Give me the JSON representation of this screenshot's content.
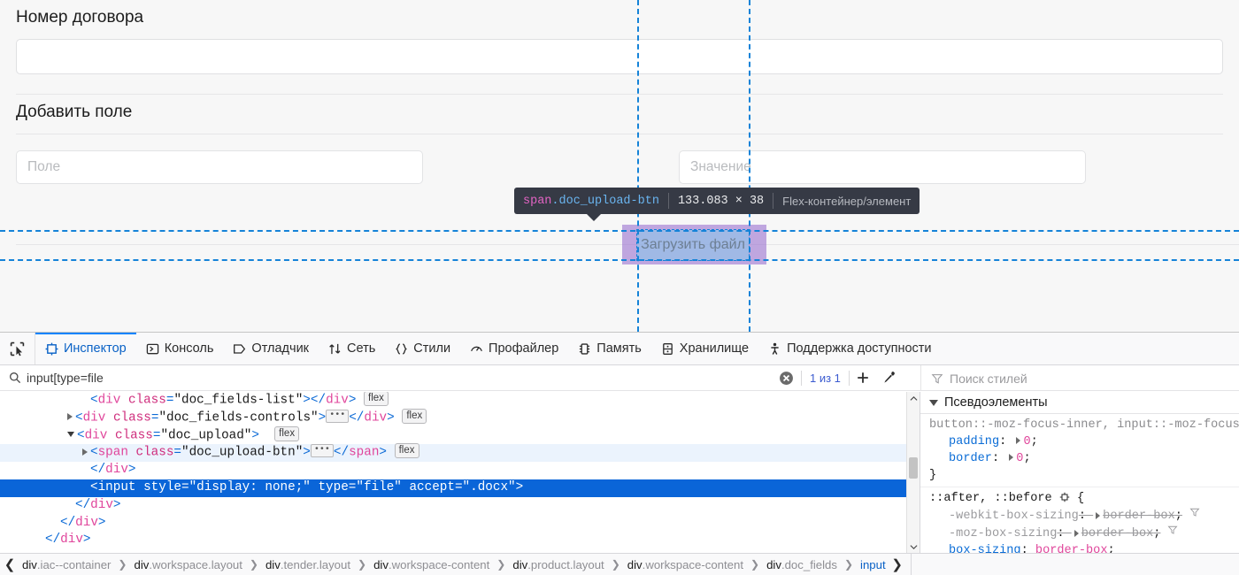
{
  "page": {
    "contract_label": "Номер договора",
    "contract_value": "",
    "add_field_label": "Добавить поле",
    "field_placeholder": "Поле",
    "value_placeholder": "Значение",
    "upload_button_label": "Загрузить файл"
  },
  "highlight": {
    "infobar": {
      "tag": "span",
      "class": ".doc_upload-btn",
      "dimensions": "133.083 × 38",
      "note": "Flex-контейнер/элемент"
    },
    "colors": {
      "margin_box": "#9265cc",
      "content_box": "#87c9e9",
      "guide_line": "#1583d8",
      "infobar_bg": "#363a45"
    }
  },
  "devtools": {
    "picker_icon": "node-picker-icon",
    "tabs": [
      {
        "label": "Инспектор",
        "icon": "inspector-icon",
        "active": true
      },
      {
        "label": "Консоль",
        "icon": "console-icon",
        "active": false
      },
      {
        "label": "Отладчик",
        "icon": "debugger-icon",
        "active": false
      },
      {
        "label": "Сеть",
        "icon": "network-icon",
        "active": false
      },
      {
        "label": "Стили",
        "icon": "style-editor-icon",
        "active": false
      },
      {
        "label": "Профайлер",
        "icon": "performance-icon",
        "active": false
      },
      {
        "label": "Память",
        "icon": "memory-icon",
        "active": false
      },
      {
        "label": "Хранилище",
        "icon": "storage-icon",
        "active": false
      },
      {
        "label": "Поддержка доступности",
        "icon": "accessibility-icon",
        "active": false
      }
    ],
    "search": {
      "value": "input[type=file",
      "icon": "search-icon",
      "clear_icon": "clear-icon",
      "match_count": "1 из 1",
      "add_icon": "plus-icon",
      "eyedropper_icon": "eyedropper-icon"
    },
    "styles_filter": {
      "placeholder": "Поиск стилей",
      "icon": "filter-icon"
    },
    "dom": {
      "rows": [
        {
          "indent": 5,
          "twisty": "none",
          "parts": [
            {
              "t": "punct",
              "v": "<"
            },
            {
              "t": "tagname",
              "v": "div"
            },
            {
              "t": "space",
              "v": " "
            },
            {
              "t": "attrname",
              "v": "class"
            },
            {
              "t": "punct",
              "v": "="
            },
            {
              "t": "attrval",
              "v": "\"doc_fields-list\""
            },
            {
              "t": "punct",
              "v": ">"
            },
            {
              "t": "punct",
              "v": "</"
            },
            {
              "t": "tagname",
              "v": "div"
            },
            {
              "t": "punct",
              "v": ">"
            },
            {
              "t": "badge",
              "v": "flex"
            }
          ]
        },
        {
          "indent": 4,
          "twisty": "closed",
          "parts": [
            {
              "t": "punct",
              "v": "<"
            },
            {
              "t": "tagname",
              "v": "div"
            },
            {
              "t": "space",
              "v": " "
            },
            {
              "t": "attrname",
              "v": "class"
            },
            {
              "t": "punct",
              "v": "="
            },
            {
              "t": "attrval",
              "v": "\"doc_fields-controls\""
            },
            {
              "t": "punct",
              "v": ">"
            },
            {
              "t": "ellipsis",
              "v": "…"
            },
            {
              "t": "punct",
              "v": "</"
            },
            {
              "t": "tagname",
              "v": "div"
            },
            {
              "t": "punct",
              "v": ">"
            },
            {
              "t": "badge",
              "v": "flex"
            }
          ]
        },
        {
          "indent": 4,
          "twisty": "open",
          "parts": [
            {
              "t": "punct",
              "v": "<"
            },
            {
              "t": "tagname",
              "v": "div"
            },
            {
              "t": "space",
              "v": " "
            },
            {
              "t": "attrname",
              "v": "class"
            },
            {
              "t": "punct",
              "v": "="
            },
            {
              "t": "attrval",
              "v": "\"doc_upload\""
            },
            {
              "t": "punct",
              "v": ">"
            },
            {
              "t": "space",
              "v": " "
            },
            {
              "t": "badge",
              "v": "flex"
            }
          ]
        },
        {
          "indent": 5,
          "twisty": "closed",
          "highlighted": true,
          "parts": [
            {
              "t": "punct",
              "v": "<"
            },
            {
              "t": "tagname",
              "v": "span"
            },
            {
              "t": "space",
              "v": " "
            },
            {
              "t": "attrname",
              "v": "class"
            },
            {
              "t": "punct",
              "v": "="
            },
            {
              "t": "attrval",
              "v": "\"doc_upload-btn\""
            },
            {
              "t": "punct",
              "v": ">"
            },
            {
              "t": "ellipsis",
              "v": "…"
            },
            {
              "t": "punct",
              "v": "</"
            },
            {
              "t": "tagname",
              "v": "span"
            },
            {
              "t": "punct",
              "v": ">"
            },
            {
              "t": "badge",
              "v": "flex"
            }
          ]
        },
        {
          "indent": 5,
          "twisty": "none",
          "parts": [
            {
              "t": "punct",
              "v": "</"
            },
            {
              "t": "tagname",
              "v": "div"
            },
            {
              "t": "punct",
              "v": ">"
            }
          ]
        },
        {
          "indent": 5,
          "twisty": "none",
          "selected": true,
          "parts": [
            {
              "t": "punct",
              "v": "<"
            },
            {
              "t": "tagname",
              "v": "input"
            },
            {
              "t": "space",
              "v": " "
            },
            {
              "t": "attrname",
              "v": "style"
            },
            {
              "t": "punct",
              "v": "="
            },
            {
              "t": "attrval",
              "v": "\"display: none;\""
            },
            {
              "t": "space",
              "v": " "
            },
            {
              "t": "attrname",
              "v": "type"
            },
            {
              "t": "punct",
              "v": "="
            },
            {
              "t": "attrval",
              "v": "\"file\""
            },
            {
              "t": "space",
              "v": " "
            },
            {
              "t": "attrname",
              "v": "accept"
            },
            {
              "t": "punct",
              "v": "="
            },
            {
              "t": "attrval",
              "v": "\".docx\""
            },
            {
              "t": "punct",
              "v": ">"
            }
          ]
        },
        {
          "indent": 4,
          "twisty": "none",
          "parts": [
            {
              "t": "punct",
              "v": "</"
            },
            {
              "t": "tagname",
              "v": "div"
            },
            {
              "t": "punct",
              "v": ">"
            }
          ]
        },
        {
          "indent": 3,
          "twisty": "none",
          "parts": [
            {
              "t": "punct",
              "v": "</"
            },
            {
              "t": "tagname",
              "v": "div"
            },
            {
              "t": "punct",
              "v": ">"
            }
          ]
        },
        {
          "indent": 2,
          "twisty": "none",
          "parts": [
            {
              "t": "punct",
              "v": "</"
            },
            {
              "t": "tagname",
              "v": "div"
            },
            {
              "t": "punct",
              "v": ">"
            }
          ]
        }
      ]
    },
    "styles": {
      "pseudo_header": "Псевдоэлементы",
      "rules": [
        {
          "selector": "button::-moz-focus-inner, input::-moz-focus-i",
          "selector_muted": true,
          "declarations": [
            {
              "prop": "padding",
              "value": "0",
              "expander": true,
              "struck": false,
              "filter": false
            },
            {
              "prop": "border",
              "value": "0",
              "expander": true,
              "struck": false,
              "filter": false
            }
          ]
        },
        {
          "selector": "::after, ::before",
          "selector_muted": false,
          "has_state_icon": true,
          "declarations": [
            {
              "prop": "-webkit-box-sizing",
              "value": "border-box",
              "expander": true,
              "struck": true,
              "filter": true
            },
            {
              "prop": "-moz-box-sizing",
              "value": "border-box",
              "expander": true,
              "struck": true,
              "filter": true
            },
            {
              "prop": "box-sizing",
              "value": "border-box",
              "expander": false,
              "struck": false,
              "filter": false
            }
          ]
        }
      ]
    },
    "breadcrumb": {
      "back_icon": "chevron-left-icon",
      "forward_icon": "chevron-right-icon",
      "items": [
        {
          "tag": "div",
          "cls": ".iac--container",
          "current": false
        },
        {
          "tag": "div",
          "cls": ".workspace.layout",
          "current": false
        },
        {
          "tag": "div",
          "cls": ".tender.layout",
          "current": false
        },
        {
          "tag": "div",
          "cls": ".workspace-content",
          "current": false
        },
        {
          "tag": "div",
          "cls": ".product.layout",
          "current": false
        },
        {
          "tag": "div",
          "cls": ".workspace-content",
          "current": false
        },
        {
          "tag": "div",
          "cls": ".doc_fields",
          "current": false
        },
        {
          "tag": "input",
          "cls": "",
          "current": true
        }
      ],
      "separator": "❯"
    }
  }
}
